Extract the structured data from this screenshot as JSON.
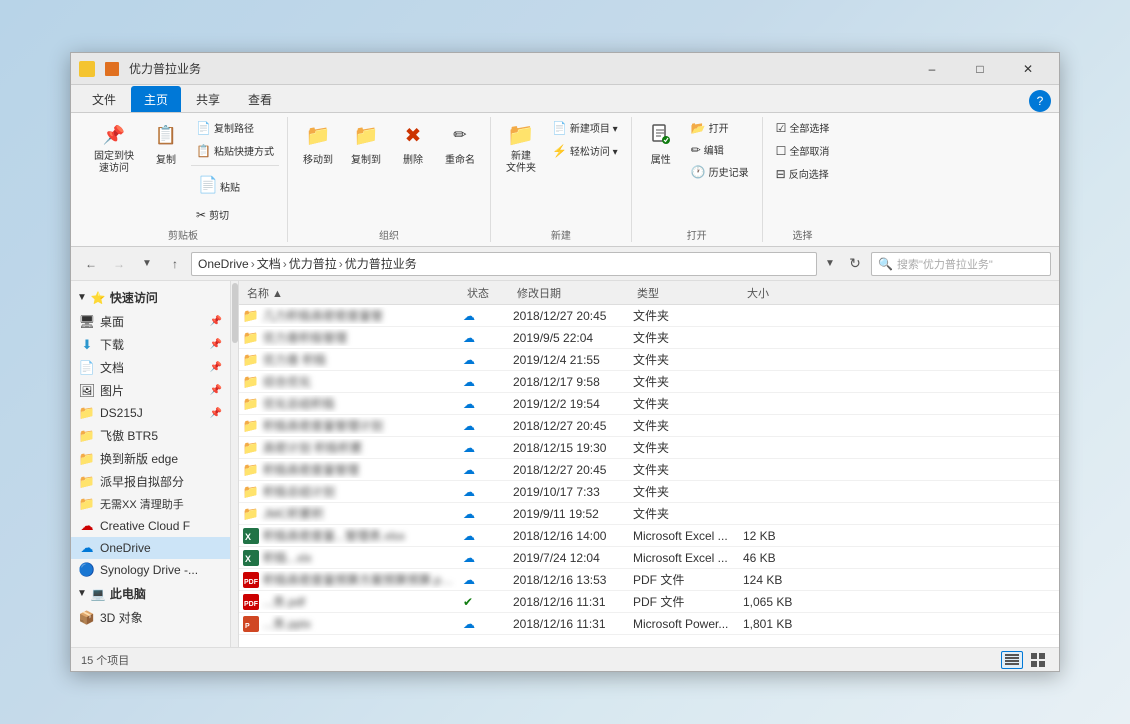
{
  "window": {
    "title": "优力普拉业务",
    "title_icon_color": "#f4c430"
  },
  "ribbon_tabs": [
    "文件",
    "主页",
    "共享",
    "查看"
  ],
  "active_tab": "主页",
  "ribbon": {
    "groups": [
      {
        "label": "剪贴板",
        "buttons": [
          {
            "id": "pin",
            "label": "固定到快\n速访问",
            "icon": "📌"
          },
          {
            "id": "copy",
            "label": "复制",
            "icon": "📋"
          },
          {
            "id": "paste",
            "label": "粘贴",
            "icon": "📄"
          }
        ],
        "small_buttons": [
          {
            "id": "copy-path",
            "label": "复制路径",
            "icon": ""
          },
          {
            "id": "paste-shortcut",
            "label": "粘贴快捷方式",
            "icon": ""
          },
          {
            "id": "cut",
            "label": "剪切",
            "icon": "✂"
          }
        ]
      },
      {
        "label": "组织",
        "buttons": [
          {
            "id": "move-to",
            "label": "移动到",
            "icon": "→"
          },
          {
            "id": "copy-to",
            "label": "复制到",
            "icon": "⊞"
          },
          {
            "id": "delete",
            "label": "删除",
            "icon": "✖"
          },
          {
            "id": "rename",
            "label": "重命名",
            "icon": "✏"
          }
        ]
      },
      {
        "label": "新建",
        "buttons": [
          {
            "id": "new-folder",
            "label": "新建\n文件夹",
            "icon": "📁"
          }
        ],
        "small_buttons": [
          {
            "id": "new-item",
            "label": "新建项目 ▾",
            "icon": ""
          },
          {
            "id": "easy-access",
            "label": "轻松访问 ▾",
            "icon": ""
          }
        ]
      },
      {
        "label": "打开",
        "buttons": [
          {
            "id": "properties",
            "label": "属性",
            "icon": "⬜"
          }
        ],
        "small_buttons": [
          {
            "id": "open",
            "label": "打开",
            "icon": ""
          },
          {
            "id": "edit",
            "label": "编辑",
            "icon": ""
          },
          {
            "id": "history",
            "label": "历史记录",
            "icon": ""
          }
        ]
      },
      {
        "label": "选择",
        "small_buttons": [
          {
            "id": "select-all",
            "label": "全部选择",
            "icon": ""
          },
          {
            "id": "select-none",
            "label": "全部取消",
            "icon": ""
          },
          {
            "id": "invert",
            "label": "反向选择",
            "icon": ""
          }
        ]
      }
    ]
  },
  "nav": {
    "back_disabled": false,
    "forward_disabled": true,
    "up_disabled": false,
    "breadcrumb": [
      "OneDrive",
      "文档",
      "优力普拉",
      "优力普拉业务"
    ],
    "search_placeholder": "搜索\"优力普拉业务\""
  },
  "sidebar": {
    "items": [
      {
        "id": "quick-access",
        "label": "快速访问",
        "icon": "⭐",
        "section": true
      },
      {
        "id": "desktop",
        "label": "桌面",
        "icon": "🖥",
        "pin": true
      },
      {
        "id": "downloads",
        "label": "下载",
        "icon": "⬇",
        "pin": true
      },
      {
        "id": "documents",
        "label": "文档",
        "icon": "📄",
        "pin": true
      },
      {
        "id": "pictures",
        "label": "图片",
        "icon": "🖼",
        "pin": true
      },
      {
        "id": "ds215j",
        "label": "DS215J",
        "icon": "📁",
        "pin": true
      },
      {
        "id": "feijiao",
        "label": "飞傲 BTR5",
        "icon": "📁"
      },
      {
        "id": "edge",
        "label": "换到新版 edge",
        "icon": "📁"
      },
      {
        "id": "report",
        "label": "派早报自拟部分",
        "icon": "📁"
      },
      {
        "id": "wumao",
        "label": "无需XX 清理助手",
        "icon": "📁"
      },
      {
        "id": "creative-cloud",
        "label": "Creative Cloud F",
        "icon": "☁",
        "color": "#cc0000"
      },
      {
        "id": "onedrive",
        "label": "OneDrive",
        "icon": "☁",
        "selected": true,
        "color": "#0078d7"
      },
      {
        "id": "synology",
        "label": "Synology Drive -...",
        "icon": "🔵"
      },
      {
        "id": "this-pc",
        "label": "此电脑",
        "icon": "💻",
        "section": true
      },
      {
        "id": "3d-objects",
        "label": "3D 对象",
        "icon": "📦"
      }
    ]
  },
  "file_list": {
    "columns": [
      "名称",
      "状态",
      "修改日期",
      "类型",
      "大小"
    ],
    "files": [
      {
        "name": "几力积极高密密度量管",
        "type": "文件夹",
        "date": "2018/12/27 20:45",
        "status": "cloud",
        "icon": "folder"
      },
      {
        "name": "优力普积极管理",
        "type": "文件夹",
        "date": "2019/9/5 22:04",
        "status": "cloud",
        "icon": "folder"
      },
      {
        "name": "优力普 积极",
        "type": "文件夹",
        "date": "2019/12/4 21:55",
        "status": "cloud",
        "icon": "folder"
      },
      {
        "name": "综合优化",
        "type": "文件夹",
        "date": "2018/12/17 9:58",
        "status": "cloud",
        "icon": "folder"
      },
      {
        "name": "优化总结积极",
        "type": "文件夹",
        "date": "2019/12/2 19:54",
        "status": "cloud",
        "icon": "folder"
      },
      {
        "name": "积极高密度量管理计划",
        "type": "文件夹",
        "date": "2018/12/27 20:45",
        "status": "cloud",
        "icon": "folder"
      },
      {
        "name": "高密计划 积极积累",
        "type": "文件夹",
        "date": "2018/12/15 19:30",
        "status": "cloud",
        "icon": "folder"
      },
      {
        "name": "积极高密度量管理",
        "type": "文件夹",
        "date": "2018/12/27 20:45",
        "status": "cloud",
        "icon": "folder"
      },
      {
        "name": "积极总结计划",
        "type": "文件夹",
        "date": "2019/10/17 7:33",
        "status": "cloud",
        "icon": "folder"
      },
      {
        "name": "JMC积累积",
        "type": "文件夹",
        "date": "2019/9/11 19:52",
        "status": "cloud",
        "icon": "folder"
      },
      {
        "name": "积极高密度量...管理表.xlsx",
        "type": "Microsoft Excel ...",
        "date": "2018/12/16 14:00",
        "status": "cloud",
        "icon": "excel",
        "size": "12 KB"
      },
      {
        "name": "积极...xlx",
        "type": "Microsoft Excel ...",
        "date": "2019/7/24 12:04",
        "status": "cloud",
        "icon": "excel",
        "size": "46 KB"
      },
      {
        "name": "积极高密度量预算方案预算预算.pdf预算",
        "type": "PDF 文件",
        "date": "2018/12/16 13:53",
        "status": "cloud",
        "icon": "pdf",
        "size": "124 KB"
      },
      {
        "name": "...务.pdf",
        "type": "PDF 文件",
        "date": "2018/12/16 11:31",
        "status": "ok",
        "icon": "pdf",
        "size": "1,065 KB"
      },
      {
        "name": "...务.pptx",
        "type": "Microsoft Power...",
        "date": "2018/12/16 11:31",
        "status": "cloud",
        "icon": "pptx",
        "size": "1,801 KB"
      }
    ]
  },
  "status_bar": {
    "count_text": "15 个项目"
  }
}
